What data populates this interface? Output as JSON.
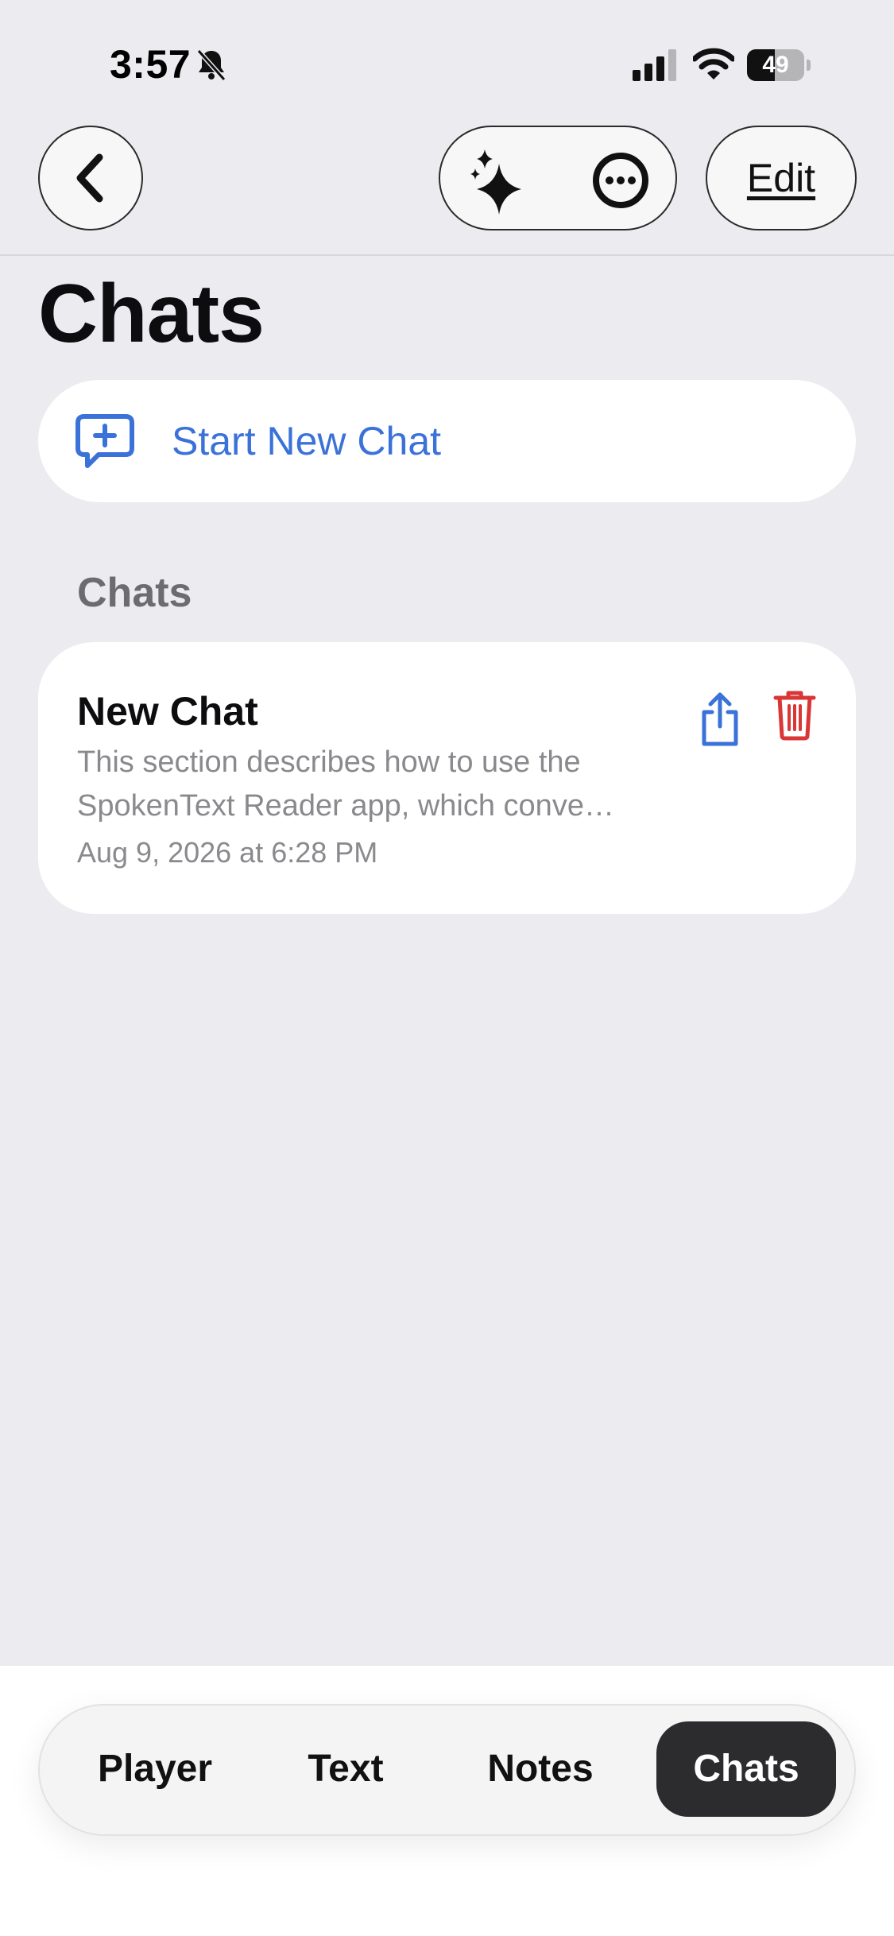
{
  "status_bar": {
    "time": "3:57",
    "battery": "49",
    "battery_level": 0.49
  },
  "nav": {
    "edit_label": "Edit"
  },
  "title": "Chats",
  "start_new_chat": {
    "label": "Start New Chat"
  },
  "section_header": "Chats",
  "chats": [
    {
      "title": "New Chat",
      "preview": "This section describes how to use the SpokenText Reader app, which conve…",
      "date": "Aug 9, 2026 at 6:28 PM"
    }
  ],
  "tabs": [
    {
      "label": "Player",
      "selected": false
    },
    {
      "label": "Text",
      "selected": false
    },
    {
      "label": "Notes",
      "selected": false
    },
    {
      "label": "Chats",
      "selected": true
    }
  ],
  "colors": {
    "accent": "#3A72D9",
    "destructive": "#D93636",
    "selected_tab": "#2C2C2E",
    "background": "#EBEBF0"
  },
  "icons": [
    "bell-slash-icon",
    "signal-icon",
    "wifi-icon",
    "battery-icon",
    "chevron-left-icon",
    "sparkles-icon",
    "ellipsis-circle-icon",
    "new-chat-icon",
    "share-icon",
    "trash-icon"
  ]
}
